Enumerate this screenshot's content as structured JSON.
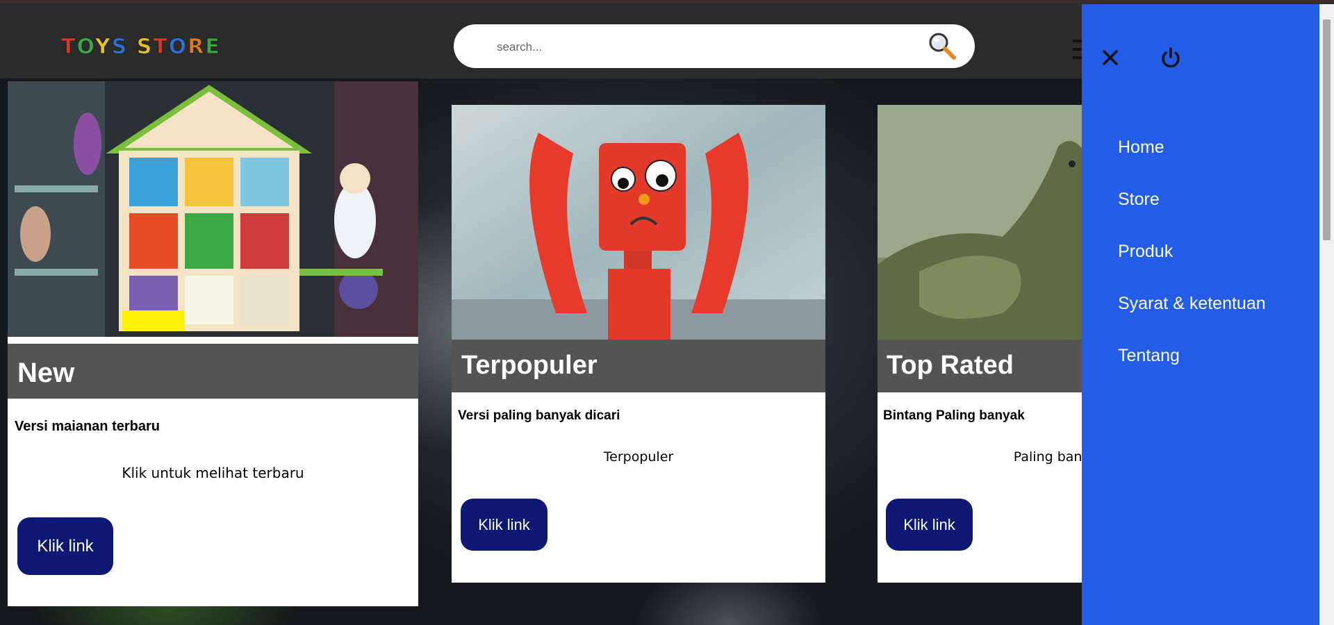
{
  "header": {
    "logo_letters": [
      {
        "char": "T",
        "color": "#d33a2c"
      },
      {
        "char": "O",
        "color": "#3aa845"
      },
      {
        "char": "Y",
        "color": "#e6c229"
      },
      {
        "char": "S",
        "color": "#2e6fd1"
      },
      {
        "char": " ",
        "color": "#ffffff"
      },
      {
        "char": "S",
        "color": "#e6c229"
      },
      {
        "char": "T",
        "color": "#d33a2c"
      },
      {
        "char": "O",
        "color": "#2e6fd1"
      },
      {
        "char": "R",
        "color": "#e07a1f"
      },
      {
        "char": "E",
        "color": "#3aa845"
      }
    ],
    "search_placeholder": "search..."
  },
  "cards": [
    {
      "title": "New",
      "subtitle": "Versi maianan terbaru",
      "text": "Klik untuk melihat terbaru",
      "button": "Klik link",
      "image": "dollhouse-toy-shop-image"
    },
    {
      "title": "Terpopuler",
      "subtitle": "Versi paling banyak dicari",
      "text": "Terpopuler",
      "button": "Klik link",
      "image": "red-robot-toy-image"
    },
    {
      "title": "Top Rated",
      "subtitle": "Bintang Paling banyak",
      "text": "Paling banyak r",
      "button": "Klik link",
      "image": "dinosaur-toy-image"
    }
  ],
  "sidebar": {
    "items": [
      "Home",
      "Store",
      "Produk",
      "Syarat & ketentuan",
      "Tentang"
    ]
  },
  "colors": {
    "sidebar": "#235de5",
    "button": "#0d1875",
    "navbar": "#2b2b2b",
    "title_bar": "#545454"
  }
}
